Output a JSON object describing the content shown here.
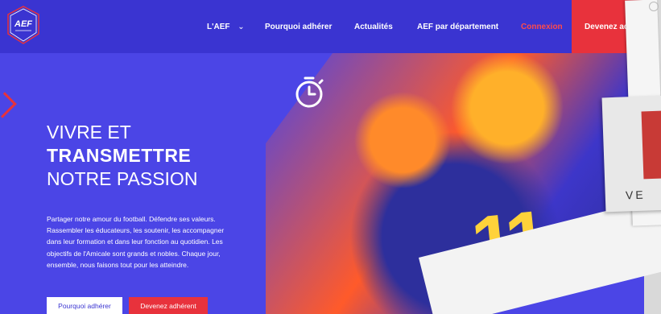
{
  "nav": {
    "logo_text": "AEF",
    "items": [
      {
        "label": "L'AEF",
        "has_dropdown": true
      },
      {
        "label": "Pourquoi adhérer"
      },
      {
        "label": "Actualités"
      },
      {
        "label": "AEF par département"
      },
      {
        "label": "Connexion",
        "color": "#ff4b4b"
      }
    ],
    "cta_label": "Devenez ad"
  },
  "hero": {
    "title_line1": "VIVRE ET",
    "title_line2": "TRANSMETTRE",
    "title_line3": "NOTRE PASSION",
    "paragraph": "Partager notre amour du football. Défendre ses valeurs. Rassembler les éducateurs, les soutenir, les accompagner dans leur formation et dans leur fonction au quotidien. Les objectifs de l'Amicale sont grands et nobles. Chaque jour, ensemble, nous faisons tout pour les atteindre.",
    "button_primary": "Pourquoi adhérer",
    "button_secondary": "Devenez adhérent",
    "jersey_number": "11"
  },
  "side_preview": {
    "text": "VE"
  },
  "colors": {
    "brand_blue": "#4b45e6",
    "nav_blue": "#3a34d1",
    "accent_red": "#e8323c"
  }
}
